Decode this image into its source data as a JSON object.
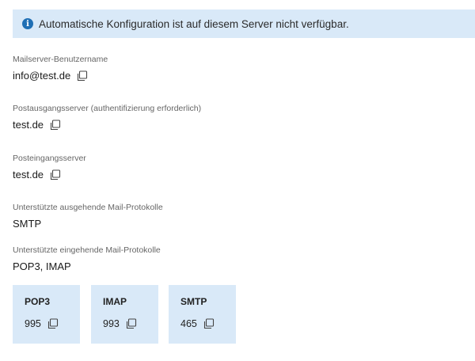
{
  "banner": {
    "text": "Automatische Konfiguration ist auf diesem Server nicht verfügbar.",
    "icon": "info-icon"
  },
  "fields": {
    "username": {
      "label": "Mailserver-Benutzername",
      "value": "info@test.de"
    },
    "outgoing_server": {
      "label": "Postausgangsserver (authentifizierung erforderlich)",
      "value": "test.de"
    },
    "incoming_server": {
      "label": "Posteingangsserver",
      "value": "test.de"
    },
    "outgoing_protocols": {
      "label": "Unterstützte ausgehende Mail-Protokolle",
      "value": "SMTP"
    },
    "incoming_protocols": {
      "label": "Unterstützte eingehende Mail-Protokolle",
      "value": "POP3, IMAP"
    }
  },
  "ports": [
    {
      "protocol": "POP3",
      "port": "995"
    },
    {
      "protocol": "IMAP",
      "port": "993"
    },
    {
      "protocol": "SMTP",
      "port": "465"
    }
  ],
  "colors": {
    "banner_bg": "#d9e9f8",
    "info_icon": "#1f6fb5",
    "port_box_bg": "#d9e9f8"
  }
}
